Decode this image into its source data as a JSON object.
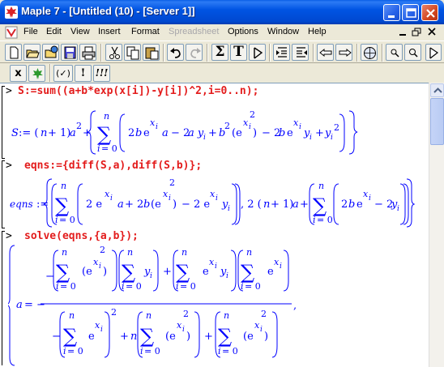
{
  "window": {
    "title": "Maple 7  - [Untitled (10) - [Server 1]]",
    "controls": [
      "minimize",
      "maximize",
      "close"
    ]
  },
  "menu": {
    "items": [
      {
        "label": "File",
        "enabled": true
      },
      {
        "label": "Edit",
        "enabled": true
      },
      {
        "label": "View",
        "enabled": true
      },
      {
        "label": "Insert",
        "enabled": true
      },
      {
        "label": "Format",
        "enabled": true
      },
      {
        "label": "Spreadsheet",
        "enabled": false
      },
      {
        "label": "Options",
        "enabled": true
      },
      {
        "label": "Window",
        "enabled": true
      },
      {
        "label": "Help",
        "enabled": true
      }
    ]
  },
  "toolbar": {
    "buttons": [
      "new-icon",
      "open-icon",
      "open-url-icon",
      "save-icon",
      "print-icon",
      "cut-icon",
      "copy-icon",
      "paste-icon",
      "undo-icon",
      "redo-icon",
      "sigma-icon",
      "text-T-icon",
      "input-prompt-icon",
      "group-left-icon",
      "group-right-icon",
      "back-arrow-icon",
      "forward-arrow-icon",
      "stop-icon",
      "zoom-in-icon",
      "zoom-out-icon",
      "restart-icon"
    ],
    "sum_symbol": "Σ",
    "text_symbol": "T"
  },
  "toolbar2": {
    "buttons": [
      {
        "name": "math-mode-x",
        "label": "x"
      },
      {
        "name": "maple-leaf",
        "label": ""
      },
      {
        "name": "execute-selection",
        "label": "(✓)"
      },
      {
        "name": "execute-single",
        "label": "!"
      },
      {
        "name": "execute-all",
        "label": "!!!"
      }
    ]
  },
  "worksheet": {
    "prompt": ">",
    "commands": [
      "S:=sum((a+b*exp(x[i])-y[i])^2,i=0..n);",
      "eqns:={diff(S,a),diff(S,b)};",
      "solve(eqns,{a,b});"
    ],
    "outputs": {
      "s_lhs": "S := (n + 1) a",
      "eqns_lhs": "eqns :=",
      "a_lhs": "a = −",
      "sum_top": "n",
      "sum_bottom": "i = 0",
      "sum_symbol": "∑",
      "exp_e": "e",
      "sub_i": "x",
      "sup_i": "i"
    }
  }
}
